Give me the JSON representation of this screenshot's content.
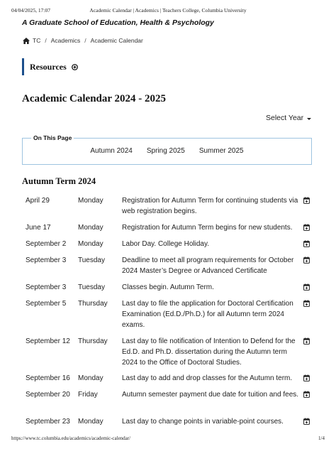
{
  "print_header": {
    "datetime": "04/04/2025, 17:07",
    "title": "Academic Calendar | Academics | Teachers College, Columbia University"
  },
  "tagline": "A Graduate School of Education, Health & Psychology",
  "breadcrumb": {
    "items": [
      "TC",
      "Academics",
      "Academic Calendar"
    ],
    "separator": "/"
  },
  "resources": {
    "label": "Resources"
  },
  "page_title": "Academic Calendar 2024 - 2025",
  "select_year": {
    "label": "Select Year"
  },
  "on_this_page": {
    "legend": "On This Page",
    "links": [
      "Autumn 2024",
      "Spring 2025",
      "Summer 2025"
    ]
  },
  "autumn_term": {
    "heading": "Autumn Term 2024",
    "rows": [
      {
        "date": "April 29",
        "day": "Monday",
        "desc": "Registration for Autumn Term for continuing students via web registration begins."
      },
      {
        "date": "June 17",
        "day": "Monday",
        "desc": "Registration for Autumn Term begins for new students."
      },
      {
        "date": "September 2",
        "day": "Monday",
        "desc": "Labor Day. College Holiday."
      },
      {
        "date": "September 3",
        "day": "Tuesday",
        "desc": "Deadline to meet all program requirements for October 2024 Master’s Degree or Advanced Certificate"
      },
      {
        "date": "September 3",
        "day": "Tuesday",
        "desc": "Classes begin. Autumn Term."
      },
      {
        "date": "September 5",
        "day": "Thursday",
        "desc": "Last day to file the application for Doctoral Certification Examination (Ed.D./Ph.D.) for all Autumn term 2024 exams."
      },
      {
        "date": "September 12",
        "day": "Thursday",
        "desc": "Last day to file notification of Intention to Defend for the Ed.D. and Ph.D. dissertation during the Autumn term 2024 to the Office of Doctoral Studies."
      },
      {
        "date": "September 16",
        "day": "Monday",
        "desc": "Last day to add and drop classes for the Autumn term."
      },
      {
        "date": "September 20",
        "day": "Friday",
        "desc": "Autumn semester payment due date for tuition and fees."
      },
      {
        "date": "September 23",
        "day": "Monday",
        "desc": "Last day to change points in variable-point courses."
      }
    ]
  },
  "print_footer": {
    "url": "https://www.tc.columbia.edu/academics/academic-calendar/",
    "page": "1/4"
  },
  "icons": {
    "home": "home-icon",
    "plus": "plus-circle-icon",
    "calendar": "calendar-add-icon"
  }
}
